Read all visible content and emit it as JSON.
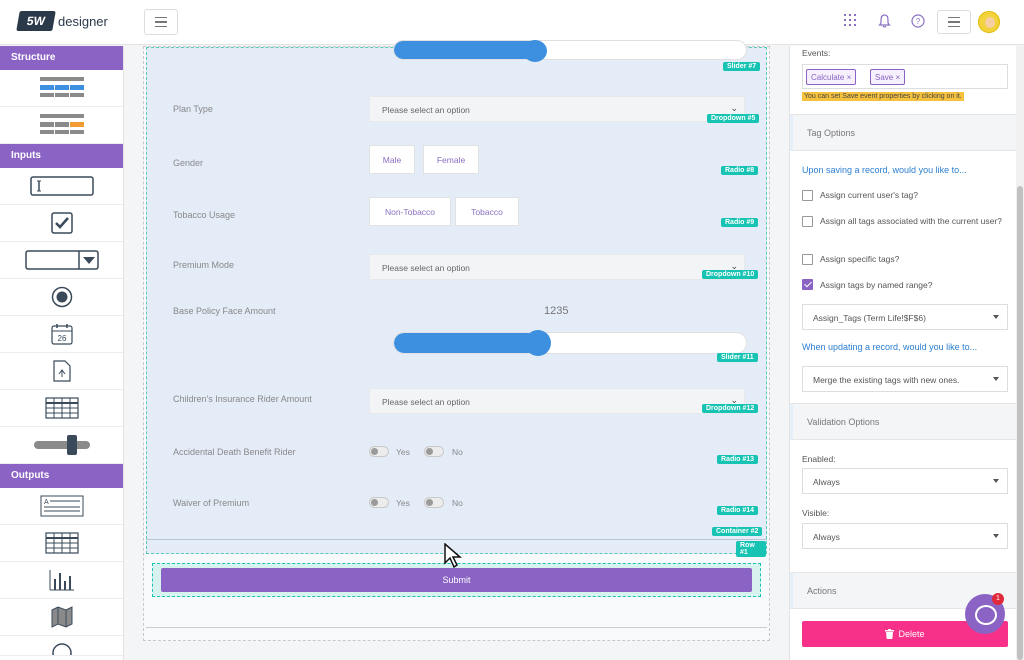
{
  "app": {
    "logo_mark": "5W",
    "logo_text": "designer"
  },
  "header_icons": [
    "grid-icon",
    "bell-icon",
    "help-icon",
    "menu-icon",
    "avatar"
  ],
  "left_sidebar": {
    "sections": [
      {
        "title": "Structure",
        "tools": [
          "layout-row-tool",
          "layout-columns-tool"
        ]
      },
      {
        "title": "Inputs",
        "tools": [
          "textbox-tool",
          "checkbox-tool",
          "dropdown-tool",
          "radio-tool",
          "date-tool",
          "file-upload-tool",
          "grid-tool",
          "slider-tool"
        ]
      },
      {
        "title": "Outputs",
        "tools": [
          "text-output-tool",
          "table-output-tool",
          "chart-tool",
          "map-tool",
          "gauge-tool"
        ]
      }
    ],
    "date_tool_day": "26"
  },
  "form": {
    "slider7_tag": "Slider #7",
    "plan_type": {
      "label": "Plan Type",
      "placeholder": "Please select an option",
      "tag": "Dropdown #5"
    },
    "gender": {
      "label": "Gender",
      "options": [
        "Male",
        "Female"
      ],
      "tag": "Radio #8"
    },
    "tobacco": {
      "label": "Tobacco Usage",
      "options": [
        "Non-Tobacco",
        "Tobacco"
      ],
      "tag": "Radio #9"
    },
    "premium_mode": {
      "label": "Premium Mode",
      "placeholder": "Please select an option",
      "tag": "Dropdown #10"
    },
    "face_amount": {
      "label": "Base Policy Face Amount",
      "value": "1235",
      "tag": "Slider #11",
      "fill_fraction": 0.41
    },
    "children_rider": {
      "label": "Children's Insurance Rider Amount",
      "placeholder": "Please select an option",
      "tag": "Dropdown #12"
    },
    "adb_rider": {
      "label": "Accidental Death Benefit Rider",
      "yes": "Yes",
      "no": "No",
      "tag": "Radio #13"
    },
    "waiver": {
      "label": "Waiver of Premium",
      "yes": "Yes",
      "no": "No",
      "tag": "Radio #14"
    },
    "container_tag": "Container #2",
    "row_tag": "Row #1",
    "submit_label": "Submit"
  },
  "right_panel": {
    "events_label": "Events:",
    "events": [
      "Calculate",
      "Save"
    ],
    "events_hint": "You can set Save event properties by clicking on it.",
    "tag_options_title": "Tag Options",
    "saving_question": "Upon saving a record, would you like to...",
    "checkboxes": [
      {
        "label": "Assign current user's tag?",
        "checked": false
      },
      {
        "label": "Assign all tags associated with the current user?",
        "checked": false
      },
      {
        "label": "Assign specific tags?",
        "checked": false
      },
      {
        "label": "Assign tags by named range?",
        "checked": true
      }
    ],
    "named_range_value": "Assign_Tags (Term Life!$F$6)",
    "updating_question": "When updating a record, would you like to...",
    "update_value": "Merge the existing tags with new ones.",
    "validation_title": "Validation Options",
    "enabled_label": "Enabled:",
    "enabled_value": "Always",
    "visible_label": "Visible:",
    "visible_value": "Always",
    "actions_title": "Actions",
    "delete_label": "Delete"
  },
  "chat_badge": "1",
  "colors": {
    "accent": "#8a63c4",
    "tag": "#17c3b2",
    "slider": "#3d8fe0",
    "delete": "#f7318a",
    "link": "#2a7fd1"
  }
}
